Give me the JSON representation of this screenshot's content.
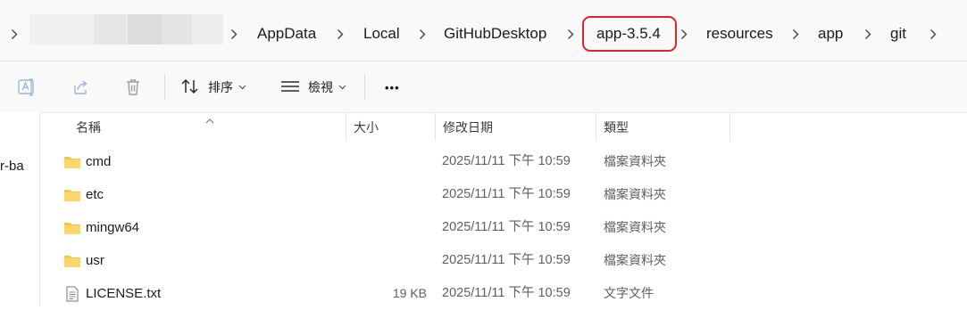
{
  "breadcrumb": {
    "items": [
      "AppData",
      "Local",
      "GitHubDesktop",
      "app-3.5.4",
      "resources",
      "app",
      "git"
    ],
    "highlighted": "app-3.5.4",
    "highlight_color": "#e0242b"
  },
  "toolbar": {
    "sort_label": "排序",
    "view_label": "檢視",
    "more_label": "•••",
    "icons": [
      "rename-icon",
      "share-icon",
      "delete-icon",
      "sort-icon",
      "view-icon"
    ]
  },
  "columns": {
    "name": "名稱",
    "size": "大小",
    "date": "修改日期",
    "type": "類型"
  },
  "left_pane": {
    "clipped_text": "r-ba"
  },
  "files": [
    {
      "name": "cmd",
      "size": "",
      "date": "2025/11/11 下午 10:59",
      "type": "檔案資料夾",
      "icon": "folder-icon"
    },
    {
      "name": "etc",
      "size": "",
      "date": "2025/11/11 下午 10:59",
      "type": "檔案資料夾",
      "icon": "folder-icon"
    },
    {
      "name": "mingw64",
      "size": "",
      "date": "2025/11/11 下午 10:59",
      "type": "檔案資料夾",
      "icon": "folder-icon"
    },
    {
      "name": "usr",
      "size": "",
      "date": "2025/11/11 下午 10:59",
      "type": "檔案資料夾",
      "icon": "folder-icon"
    },
    {
      "name": "LICENSE.txt",
      "size": "19 KB",
      "date": "2025/11/11 下午 10:59",
      "type": "文字文件",
      "icon": "text-file-icon"
    }
  ],
  "colors": {
    "folder": "#f5c84c",
    "accent": "#e0242b"
  }
}
